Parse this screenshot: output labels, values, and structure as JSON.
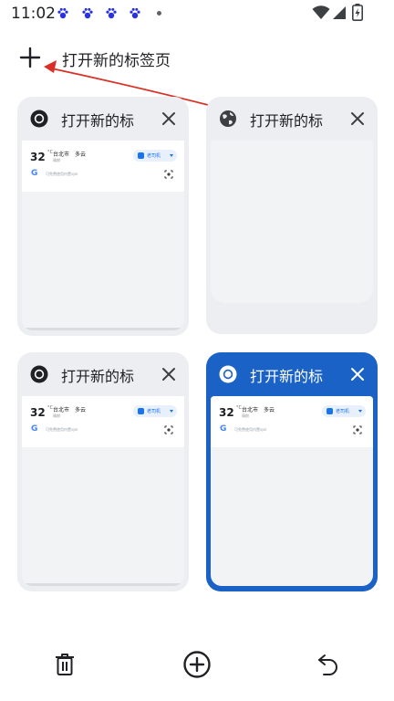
{
  "status_bar": {
    "time": "11:02",
    "icons": [
      "baidu-paw-icon",
      "baidu-paw-icon",
      "baidu-paw-icon",
      "baidu-paw-icon",
      "dot-icon",
      "wifi-icon",
      "signal-icon",
      "battery-icon"
    ]
  },
  "new_tab": {
    "label": "打开新的标签页"
  },
  "tabs": [
    {
      "title": "打开新的标",
      "favicon": "chrome-icon",
      "selected": false,
      "preview": {
        "temp": "32",
        "deg": "°C",
        "city": "台北市",
        "weather": "多云",
        "sub": "晴朗",
        "chip": "老司机",
        "search_placeholder": "可免费使用内置vpn"
      }
    },
    {
      "title": "打开新的标",
      "favicon": "globe-icon",
      "selected": false,
      "preview": null
    },
    {
      "title": "打开新的标",
      "favicon": "chrome-icon",
      "selected": false,
      "preview": {
        "temp": "32",
        "deg": "°C",
        "city": "台北市",
        "weather": "多云",
        "sub": "晴朗",
        "chip": "老司机",
        "search_placeholder": "可免费使用内置vpn"
      }
    },
    {
      "title": "打开新的标",
      "favicon": "chrome-icon",
      "selected": true,
      "preview": {
        "temp": "32",
        "deg": "°C",
        "city": "台北市",
        "weather": "多云",
        "sub": "晴朗",
        "chip": "老司机",
        "search_placeholder": "可免费使用内置vpn"
      }
    }
  ],
  "toolbar": {
    "buttons": [
      "trash-icon",
      "add-circle-icon",
      "undo-icon"
    ]
  },
  "colors": {
    "accent": "#1a62c6",
    "card_bg": "#eceef1",
    "annotation_arrow": "#d93025"
  }
}
